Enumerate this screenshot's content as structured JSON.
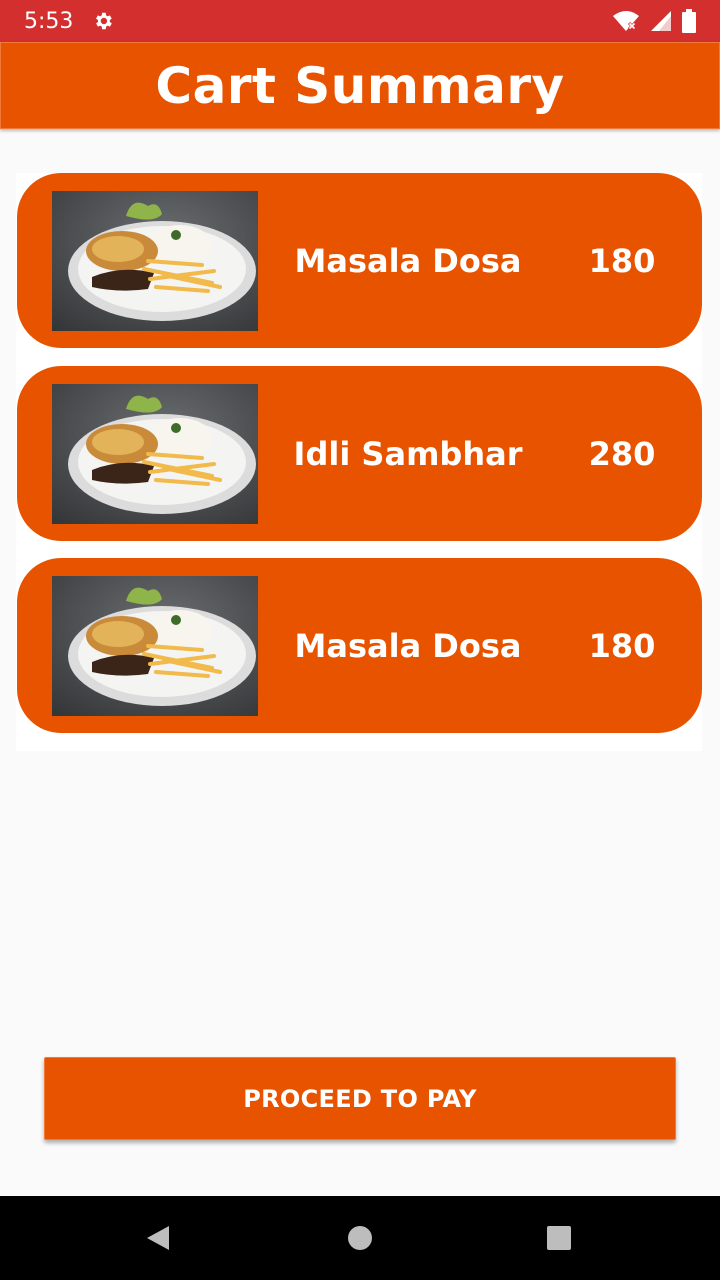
{
  "status_bar": {
    "time": "5:53",
    "icons": [
      "gear-icon",
      "wifi-icon",
      "signal-icon",
      "battery-icon"
    ],
    "background": "#d32f2f"
  },
  "app_bar": {
    "title": "Cart Summary",
    "background": "#e85300"
  },
  "cart": {
    "items": [
      {
        "name": "Masala Dosa",
        "price": "180"
      },
      {
        "name": "Idli Sambhar",
        "price": "280"
      },
      {
        "name": "Masala Dosa",
        "price": "180"
      }
    ]
  },
  "actions": {
    "pay_label": "PROCEED TO PAY"
  },
  "nav_bar": {
    "icons": [
      "back-icon",
      "home-icon",
      "recents-icon"
    ]
  },
  "colors": {
    "accent": "#e85300",
    "page_background": "#fafafa"
  }
}
